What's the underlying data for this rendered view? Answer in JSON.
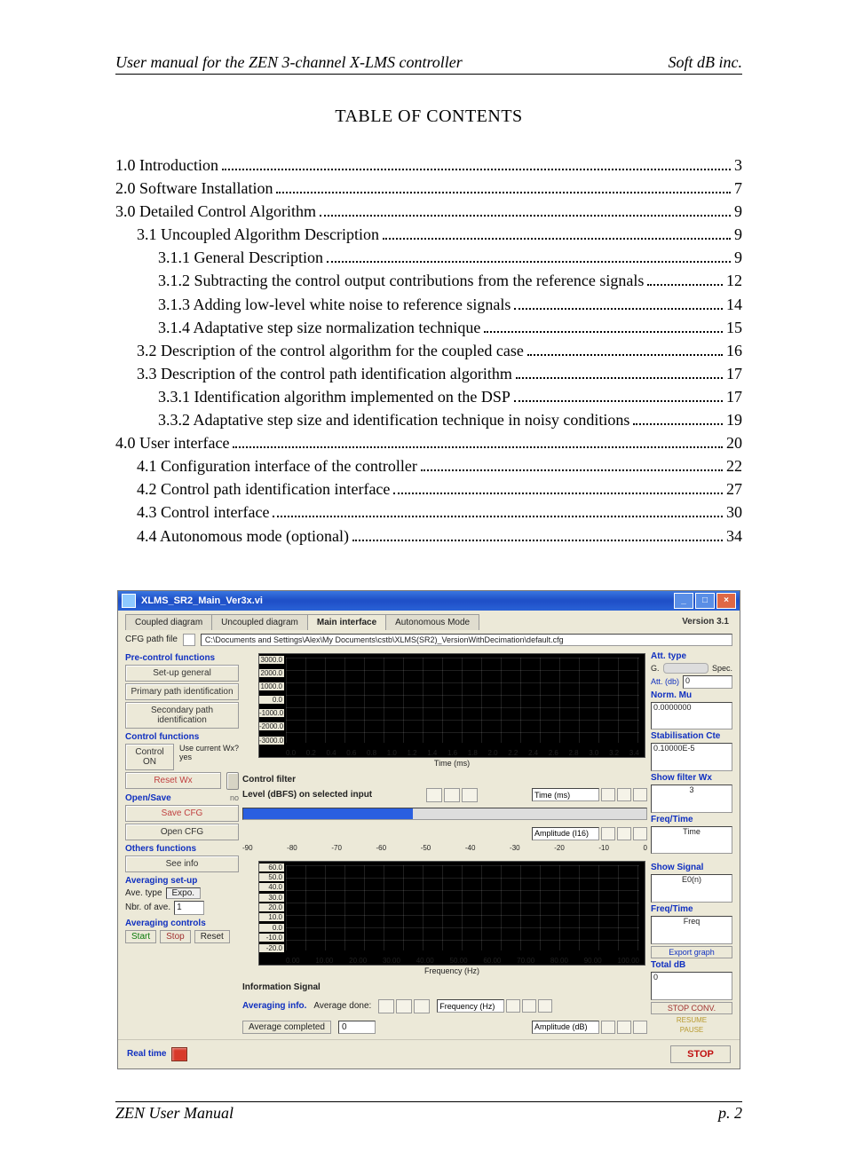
{
  "header": {
    "left": "User manual for the ZEN 3-channel X-LMS controller",
    "right": "Soft dB inc."
  },
  "toc_title": "TABLE OF CONTENTS",
  "toc": [
    {
      "label": "1.0 Introduction",
      "page": "3",
      "indent": 0
    },
    {
      "label": "2.0 Software Installation",
      "page": "7",
      "indent": 0
    },
    {
      "label": "3.0 Detailed Control Algorithm",
      "page": "9",
      "indent": 0
    },
    {
      "label": "3.1 Uncoupled Algorithm Description",
      "page": "9",
      "indent": 1
    },
    {
      "label": "3.1.1 General Description",
      "page": "9",
      "indent": 2
    },
    {
      "label": "3.1.2 Subtracting the control output contributions from the reference signals",
      "page": "12",
      "indent": 2
    },
    {
      "label": "3.1.3 Adding low-level white noise to reference signals",
      "page": "14",
      "indent": 2
    },
    {
      "label": "3.1.4 Adaptative step size normalization technique",
      "page": "15",
      "indent": 2
    },
    {
      "label": "3.2 Description of the control algorithm for the coupled case",
      "page": "16",
      "indent": 1
    },
    {
      "label": "3.3 Description of the control path identification algorithm",
      "page": "17",
      "indent": 1
    },
    {
      "label": "3.3.1 Identification algorithm implemented on the DSP",
      "page": "17",
      "indent": 2
    },
    {
      "label": "3.3.2 Adaptative step size and identification technique in noisy conditions",
      "page": "19",
      "indent": 2
    },
    {
      "label": "4.0 User interface",
      "page": "20",
      "indent": 0
    },
    {
      "label": "4.1 Configuration interface of the controller",
      "page": "22",
      "indent": 1
    },
    {
      "label": "4.2 Control path identification interface",
      "page": "27",
      "indent": 1
    },
    {
      "label": "4.3 Control interface",
      "page": "30",
      "indent": 1
    },
    {
      "label": "4.4 Autonomous mode (optional)",
      "page": "34",
      "indent": 1
    }
  ],
  "footer": {
    "left": "ZEN User Manual",
    "right": "p. 2"
  },
  "app": {
    "title": "XLMS_SR2_Main_Ver3x.vi",
    "version": "Version 3.1",
    "tabs": [
      "Coupled diagram",
      "Uncoupled diagram",
      "Main interface",
      "Autonomous Mode"
    ],
    "active_tab": 2,
    "cfg_label": "CFG path file",
    "cfg_path": "C:\\Documents and Settings\\Alex\\My Documents\\cstb\\XLMS(SR2)_VersionWithDecimation\\default.cfg",
    "sidebar": {
      "pre_control": "Pre-control functions",
      "setup_general": "Set-up general",
      "primary_path": "Primary path identification",
      "secondary_path": "Secondary path identification",
      "control_functions": "Control functions",
      "control_on": "Control ON",
      "use_current": "Use current Wx?",
      "use_current_val": "yes",
      "reset_wx": "Reset Wx",
      "open_save": "Open/Save",
      "open_save_no": "no",
      "save_cfg": "Save CFG",
      "open_cfg": "Open CFG",
      "others": "Others functions",
      "see_info": "See info",
      "avg_setup": "Averaging set-up",
      "ave_type_lbl": "Ave. type",
      "ave_type_val": "Expo.",
      "nbr_ave_lbl": "Nbr. of ave.",
      "nbr_ave_val": "1",
      "avg_controls": "Averaging controls",
      "start": "Start",
      "stop": "Stop",
      "reset": "Reset"
    },
    "plots": {
      "top": {
        "ylabel": "Amplitude (I16)",
        "yticks": [
          "3000.0",
          "2000.0",
          "1000.0",
          "0.0",
          "-1000.0",
          "-2000.0",
          "-3000.0"
        ],
        "xticks": [
          "0.0",
          "0.2",
          "0.4",
          "0.6",
          "0.8",
          "1.0",
          "1.2",
          "1.4",
          "1.6",
          "1.8",
          "2.0",
          "2.2",
          "2.4",
          "2.6",
          "2.8",
          "3.0",
          "3.2",
          "3.4"
        ],
        "xlabel": "Time (ms)",
        "caption": "Control filter"
      },
      "level": {
        "title": "Level (dBFS) on selected input",
        "ticks": [
          "-90",
          "-80",
          "-70",
          "-60",
          "-50",
          "-40",
          "-30",
          "-20",
          "-10",
          "0"
        ],
        "time_lbl": "Time (ms)",
        "amp_lbl": "Amplitude (I16)"
      },
      "bottom": {
        "ylabel": "Amplitude (dB)",
        "yticks": [
          "60.0",
          "50.0",
          "40.0",
          "30.0",
          "20.0",
          "10.0",
          "0.0",
          "-10.0",
          "-20.0"
        ],
        "xticks": [
          "0.00",
          "10.00",
          "20.00",
          "30.00",
          "40.00",
          "50.00",
          "60.00",
          "70.00",
          "80.00",
          "90.00",
          "100.00"
        ],
        "xlabel": "Frequency (Hz)",
        "caption": "Information Signal",
        "avg_info": "Averaging info.",
        "avg_done_lbl": "Average done:",
        "avg_completed": "Average completed",
        "avg_completed_val": "0",
        "freq_lbl": "Frequency (Hz)",
        "amp_lbl": "Amplitude (dB)"
      }
    },
    "right": {
      "att_type": "Att. type",
      "att_g": "G.",
      "att_spec": "Spec.",
      "att_db_lbl": "Att. (db)",
      "att_db_val": "0",
      "norm_mu": "Norm. Mu",
      "norm_mu_val": "0.0000000",
      "stab_cte": "Stabilisation Cte",
      "stab_cte_val": "0.10000E-5",
      "show_filter": "Show filter Wx",
      "show_filter_val": "3",
      "freq_time1": "Freq/Time",
      "freq_time1_val": "Time",
      "show_signal": "Show Signal",
      "show_signal_val": "E0(n)",
      "freq_time2": "Freq/Time",
      "freq_time2_val": "Freq",
      "export_graph": "Export graph",
      "total_db": "Total dB",
      "total_db_val": "0",
      "stop_conv": "STOP CONV.",
      "resume": "RESUME",
      "pause": "PAUSE"
    },
    "realtime_lbl": "Real time",
    "stop": "STOP"
  }
}
